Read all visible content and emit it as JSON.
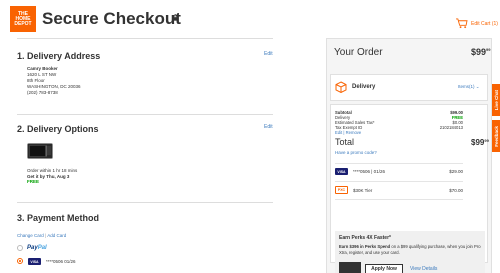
{
  "header": {
    "logo_text": "THE HOME DEPOT",
    "title": "Secure Checkout",
    "cart_edit_label": "Edit Cart (1)",
    "brand_color": "#f96302"
  },
  "delivery_address": {
    "title": "1. Delivery Address",
    "edit_label": "Edit",
    "name": "Camry Booker",
    "line1": "1620 L ST NW",
    "line2": "8th Floor",
    "line3": "WASHINGTON, DC 20036",
    "phone": "(202) 783-8738"
  },
  "delivery_options": {
    "title": "2. Delivery Options",
    "edit_label": "Edit",
    "order_within": "Order within 1 hr 18 mins",
    "get_it_by": "Get it by Thu, Aug 3",
    "shipping_cost": "FREE"
  },
  "payment_method": {
    "title": "3. Payment Method",
    "change_card": "Change Card",
    "separator": "|",
    "add_card": "Add Card",
    "paypal_part1": "Pay",
    "paypal_part2": "Pal",
    "card_brand": "VISA",
    "card_number": "****0506",
    "card_expiry": "01/26"
  },
  "order_summary": {
    "title": "Your Order",
    "total_whole": "$99",
    "total_cents": "99",
    "delivery_label": "Delivery",
    "items_label": "Items(1)",
    "rows": [
      {
        "label": "Subtotal",
        "value": "$99.00",
        "bold": true
      },
      {
        "label": "Delivery",
        "value": "FREE",
        "free": true
      },
      {
        "label": "Estimated Sales Tax*",
        "value": "$0.00"
      },
      {
        "label": "Tax Exempt ID",
        "value": "2102184013"
      }
    ],
    "edit_remove": "Edit | Remove",
    "total_label": "Total",
    "promo_link": "Have a promo code?",
    "payments": [
      {
        "brand": "VISA",
        "detail": "****0506 | 01/26",
        "amount": "$29.00"
      },
      {
        "brand": "PXC",
        "detail": "$30K Tier",
        "amount": "$70.00"
      }
    ]
  },
  "perks": {
    "title": "Earn Perks 4X Faster*",
    "text_bold": "Earn $396 in Perks Spend",
    "text_rest": " on a $99 qualifying purchase, when you join Pro Xtra, register, and use your card.",
    "apply_label": "Apply Now",
    "view_details": "View Details"
  },
  "side_tabs": {
    "live_chat": "Live Chat",
    "feedback": "Feedback"
  }
}
